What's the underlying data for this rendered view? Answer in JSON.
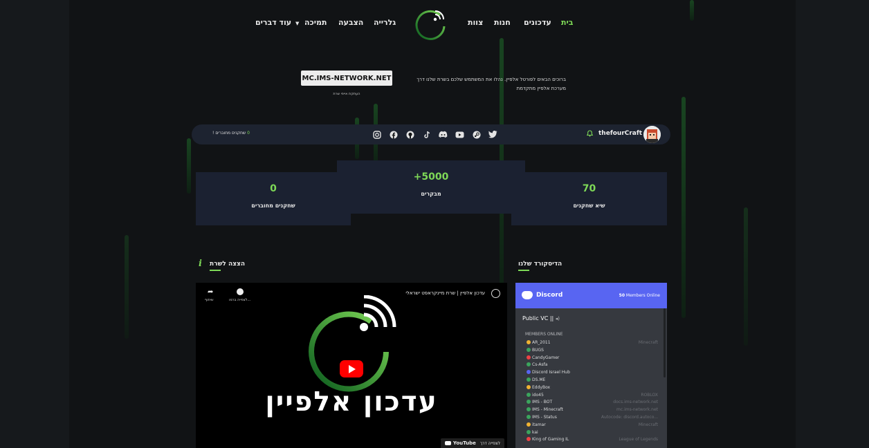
{
  "nav": {
    "items": [
      {
        "label": "בית",
        "active": true
      },
      {
        "label": "עדכונים"
      },
      {
        "label": "חנות"
      },
      {
        "label": "צוות"
      },
      {
        "label": "גלרייה"
      },
      {
        "label": "הצבעה"
      },
      {
        "label": "תמיכה"
      },
      {
        "label": "עוד דברים"
      }
    ]
  },
  "hero": {
    "server_ip": "MC.IMS-NETWORK.NET",
    "copy_hint": "העתקת אייפי שרת",
    "welcome": "ברוכים הבאים לפורטל אלפיין. נהלו את המשתמש שלכם בשרת שלנו דרך מערכת אלפיין מתקדמת"
  },
  "status_bar": {
    "online_label": "שחקנים מחוברים !",
    "online_count": "0",
    "username": "thefourCraft",
    "socials": [
      "instagram-icon",
      "facebook-icon",
      "github-icon",
      "tiktok-icon",
      "discord-icon",
      "youtube-icon",
      "steam-icon",
      "twitter-icon"
    ]
  },
  "stats": [
    {
      "value": "0",
      "label": "שחקנים מחוברים"
    },
    {
      "value": "+5000",
      "label": "מבקרים"
    },
    {
      "value": "70",
      "label": "שיא שחקנים"
    }
  ],
  "sections": {
    "server_showcase": "הצצה לשרת",
    "our_discord": "הדיסקורד שלנו"
  },
  "video": {
    "title": "עדכון אלפיין | שרת מיינקראפט ישראלי",
    "share_label": "שיתוף",
    "watch_later_label": "לצפייה ברמו...",
    "big_text": "עדכון אלפיין",
    "watch_on": "לצפייה דרך",
    "youtube": "YouTube"
  },
  "discord": {
    "name": "Discord",
    "members_online_count": "50",
    "members_online_label": "Members Online",
    "channel": "Public VC ||",
    "members_header": "MEMBERS ONLINE",
    "members": [
      {
        "name": "AR_2011",
        "game": "Minecraft",
        "color": "#f0b232"
      },
      {
        "name": "BUGS",
        "game": "",
        "color": "#3ba55d"
      },
      {
        "name": "CandyGamer",
        "game": "",
        "color": "#ed4245"
      },
      {
        "name": "Cs-Asfa",
        "game": "",
        "color": "#3ba55d"
      },
      {
        "name": "Discord Israel Hub",
        "game": "",
        "color": "#5865f2"
      },
      {
        "name": "DS.ME",
        "game": "",
        "color": "#3ba55d"
      },
      {
        "name": "EddyBox",
        "game": "",
        "color": "#f0b232"
      },
      {
        "name": "ido45",
        "game": "ROBLOX",
        "color": "#3ba55d"
      },
      {
        "name": "IMS - BOT",
        "game": "docs.ims-network.net",
        "color": "#3ba55d"
      },
      {
        "name": "IMS - Minecraft",
        "game": "mc.ims-network.net",
        "color": "#3ba55d"
      },
      {
        "name": "IMS - Status",
        "game": "Autocode: discord.autoco...",
        "color": "#3ba55d"
      },
      {
        "name": "itamar",
        "game": "Minecraft",
        "color": "#f0b232"
      },
      {
        "name": "kai",
        "game": "",
        "color": "#3ba55d"
      },
      {
        "name": "King of Gaming IL",
        "game": "League of Legends",
        "color": "#ed4245"
      }
    ]
  }
}
